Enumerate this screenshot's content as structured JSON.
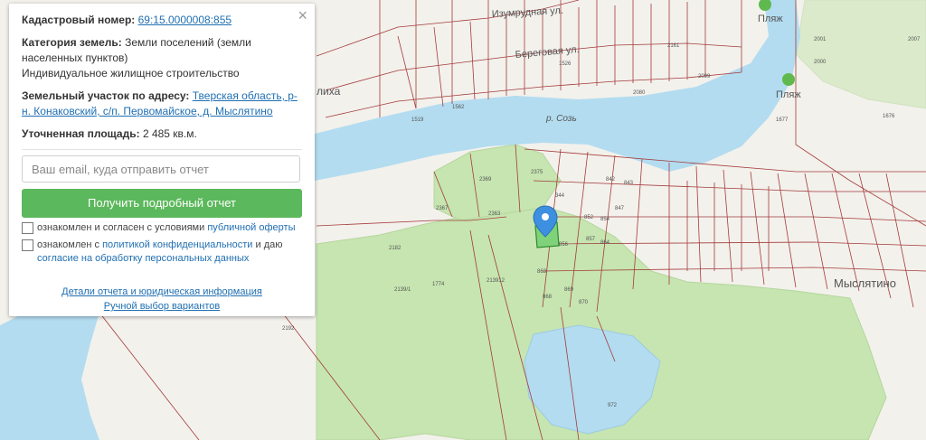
{
  "info_panel": {
    "cadastral_number": {
      "label": "Кадастровый номер:",
      "value": "69:15.0000008:855"
    },
    "land_category": {
      "label": "Категория земель:",
      "value": "Земли поселений (земли населенных пунктов)",
      "use": "Индивидуальное жилищное строительство"
    },
    "address": {
      "label": "Земельный участок по адресу:",
      "value": "Тверская область, р-н. Конаковский, с/п. Первомайское, д. Мыслятино"
    },
    "area": {
      "label": "Уточненная площадь:",
      "value": "2 485 кв.м."
    },
    "email": {
      "placeholder": "Ваш email, куда отправить отчет"
    },
    "submit_label": "Получить подробный отчет",
    "consent_offer": {
      "text": "ознакомлен и согласен с условиями ",
      "link": "публичной оферты"
    },
    "consent_privacy": {
      "text": "ознакомлен с ",
      "link": "политикой конфиденциальности",
      "text2": " и даю",
      "link2": "согласие на обработку персональных данных"
    },
    "details_link": "Детали отчета и юридическая информация",
    "manual_link": "Ручной выбор вариантов",
    "close_icon": "×"
  },
  "map": {
    "street_labels": [
      "Изумрудная ул.",
      "Береговая ул."
    ],
    "river_label": "р. Созь",
    "place_labels": [
      "Мыслятино",
      "лиха"
    ],
    "beach_labels": [
      "Пляж",
      "Пляж"
    ],
    "parcel_numbers": [
      "2375",
      "2369",
      "2367",
      "2363",
      "344",
      "842",
      "843",
      "847",
      "856",
      "857",
      "863",
      "864",
      "868",
      "869",
      "870",
      "852",
      "854",
      "2182",
      "1774",
      "1519",
      "1562",
      "1526",
      "2000",
      "2001",
      "2007",
      "1676",
      "2192",
      "2139/1",
      "213912",
      "972",
      "2161",
      "2099",
      "1677",
      "2080"
    ],
    "selected_marker": "map-pin-icon",
    "colors": {
      "water": "#b3dcf0",
      "forest": "#c6e5b0",
      "parcel_border": "#a33b3b",
      "selected_parcel": "#7fd27a",
      "pin": "#3d8fe0"
    }
  }
}
